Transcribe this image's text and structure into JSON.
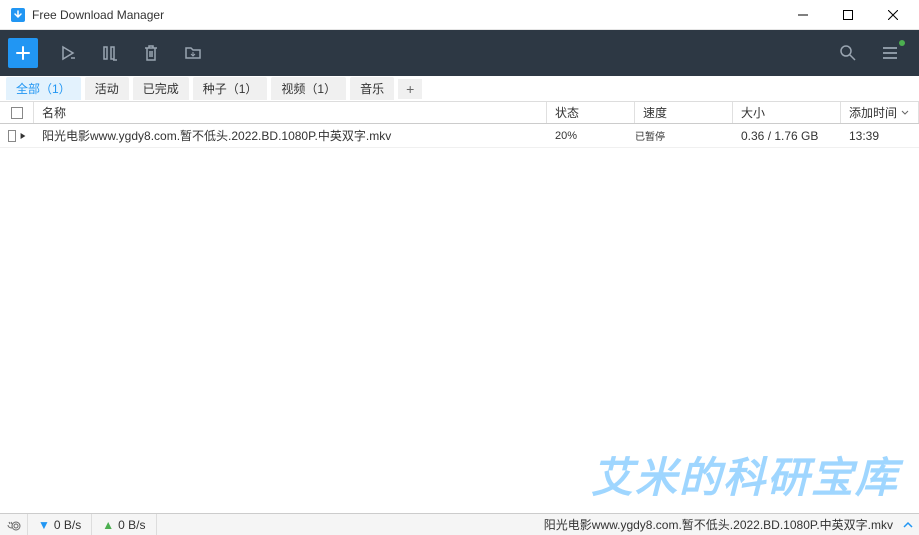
{
  "window": {
    "title": "Free Download Manager"
  },
  "tabs": {
    "all": "全部（1）",
    "active": "活动",
    "completed": "已完成",
    "seeds": "种子（1）",
    "video": "视频（1）",
    "music": "音乐"
  },
  "columns": {
    "name": "名称",
    "status": "状态",
    "speed": "速度",
    "size": "大小",
    "time": "添加时间"
  },
  "rows": [
    {
      "name": "阳光电影www.ygdy8.com.暂不低头.2022.BD.1080P.中英双字.mkv",
      "status_percent": "20%",
      "status_text": "已暂停",
      "speed": "",
      "size": "0.36 / 1.76 GB",
      "time": "13:39"
    }
  ],
  "statusbar": {
    "down_speed": "0 B/s",
    "up_speed": "0 B/s",
    "current_file": "阳光电影www.ygdy8.com.暂不低头.2022.BD.1080P.中英双字.mkv"
  },
  "watermark": "艾米的科研宝库"
}
